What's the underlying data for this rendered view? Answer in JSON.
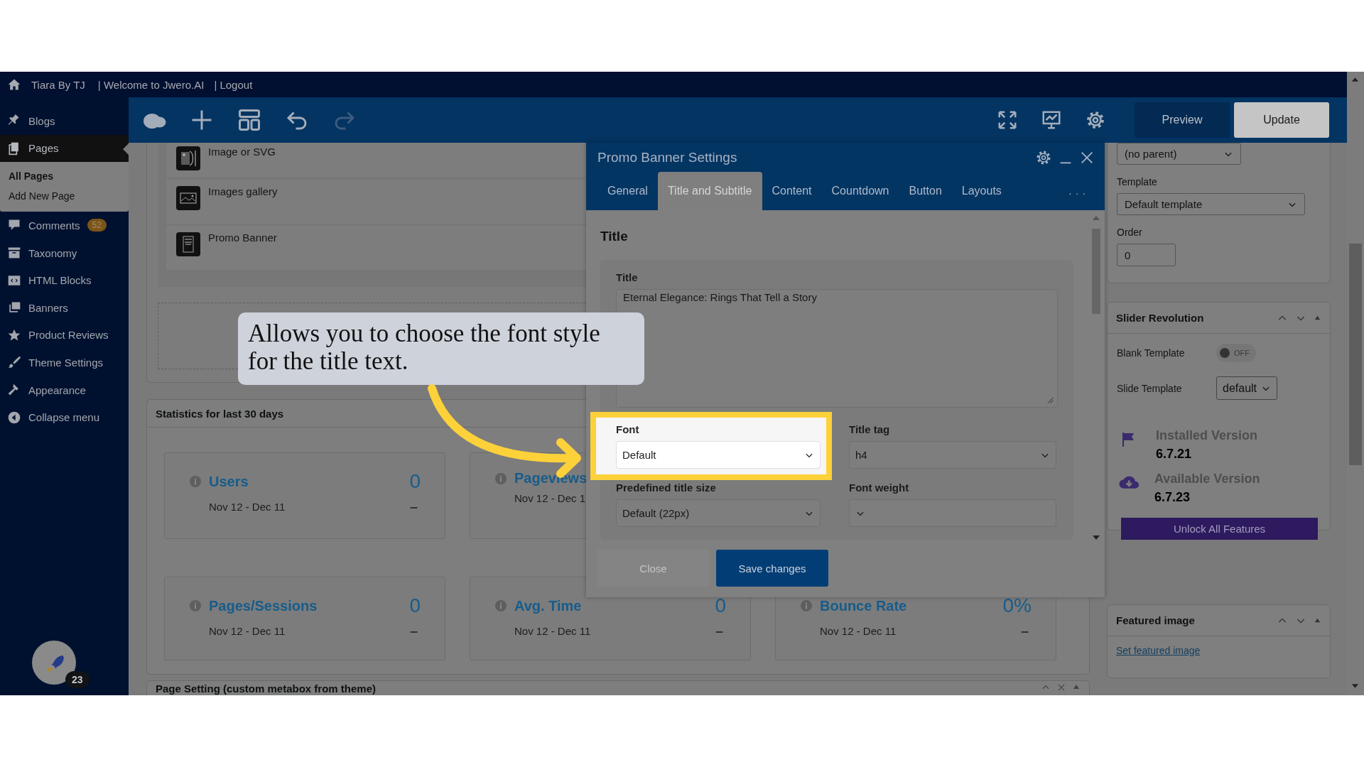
{
  "admin_bar": {
    "site": "Tiara By TJ",
    "links": [
      "| Welcome to Jwero.AI",
      "| Logout"
    ]
  },
  "sidebar": {
    "items": [
      {
        "label": "Blogs",
        "kind": "pin",
        "selected": false
      },
      {
        "label": "Pages",
        "kind": "pages",
        "selected": true,
        "children": [
          {
            "label": "All Pages",
            "selected": true
          },
          {
            "label": "Add New Page",
            "selected": false
          }
        ]
      },
      {
        "label": "Comments",
        "kind": "comment",
        "selected": false,
        "badge": "52"
      },
      {
        "label": "Taxonomy",
        "kind": "archive",
        "selected": false
      },
      {
        "label": "HTML Blocks",
        "kind": "code",
        "selected": false
      },
      {
        "label": "Banners",
        "kind": "banners",
        "selected": false
      },
      {
        "label": "Product Reviews",
        "kind": "star",
        "selected": false
      },
      {
        "label": "Theme Settings",
        "kind": "brush",
        "selected": false
      },
      {
        "label": "Appearance",
        "kind": "hammer",
        "selected": false
      },
      {
        "label": "Collapse menu",
        "kind": "collapse",
        "selected": false
      }
    ],
    "avatar_badge": "23"
  },
  "toolbar": {
    "left_tools": [
      {
        "kind": "cloud",
        "disabled": false
      },
      {
        "kind": "plus",
        "disabled": false
      },
      {
        "kind": "layout",
        "disabled": false
      },
      {
        "kind": "undo",
        "disabled": false
      },
      {
        "kind": "redo",
        "disabled": true
      }
    ],
    "right_tools": [
      {
        "kind": "expand"
      },
      {
        "kind": "chart"
      },
      {
        "kind": "gear"
      }
    ],
    "buttons": [
      {
        "label": "Preview",
        "kind": "primary"
      },
      {
        "label": "Update",
        "kind": "secondary"
      }
    ]
  },
  "elements": [
    {
      "label": "Image or SVG",
      "kind": "image-svg"
    },
    {
      "label": "Images gallery",
      "kind": "gallery"
    },
    {
      "label": "Promo Banner",
      "kind": "banner"
    }
  ],
  "statistics": {
    "title": "Statistics for last 30 days",
    "cards": [
      {
        "title": "Users",
        "value": "0",
        "change": "–",
        "range": "Nov 12 - Dec 11"
      },
      {
        "title": "Pageviews",
        "range": "Nov 12 - Dec 1"
      },
      {
        "title": "Pages/Sessions",
        "value": "0",
        "change": "–",
        "range": "Nov 12 - Dec 11"
      },
      {
        "title": "Avg. Time",
        "value": "0",
        "change": "–",
        "range": "Nov 12 - Dec 11"
      },
      {
        "title": "Bounce Rate",
        "value": "0%",
        "change": "–",
        "range": "Nov 12 - Dec 11"
      }
    ]
  },
  "page_setting": {
    "title": "Page Setting (custom metabox from theme)"
  },
  "modal": {
    "title": "Promo Banner Settings",
    "tabs": [
      {
        "label": "General",
        "selected": false
      },
      {
        "label": "Title and Subtitle",
        "selected": true
      },
      {
        "label": "Content",
        "selected": false
      },
      {
        "label": "Countdown",
        "selected": false
      },
      {
        "label": "Button",
        "selected": false
      },
      {
        "label": "Layouts",
        "selected": false
      }
    ],
    "more": ". . .",
    "section": "Title",
    "title_label": "Title",
    "title_value": "Eternal Elegance: Rings That Tell a Story",
    "fields": [
      {
        "label": "Font",
        "value": "Default",
        "highlighted": true
      },
      {
        "label": "Title tag",
        "value": "h4",
        "highlighted": false
      },
      {
        "label": "Predefined title size",
        "value": "Default (22px)",
        "highlighted": false
      },
      {
        "label": "Font weight",
        "highlighted": false
      }
    ],
    "buttons": [
      {
        "label": "Close",
        "disabled": true
      },
      {
        "label": "Save changes",
        "disabled": false
      }
    ]
  },
  "page_attributes": {
    "parent": "(no parent)",
    "template_label": "Template",
    "template": "Default template",
    "order_label": "Order",
    "order": "0"
  },
  "slider_revolution": {
    "title": "Slider Revolution",
    "blank_template_label": "Blank Template",
    "blank_template_on": false,
    "toggle_text": "OFF",
    "slide_template_label": "Slide Template",
    "slide_template": "default",
    "installed_label": "Installed Version",
    "installed": "6.7.21",
    "available_label": "Available Version",
    "available": "6.7.23",
    "unlock": "Unlock All Features"
  },
  "featured_image": {
    "title": "Featured image",
    "link": "Set featured image"
  },
  "callout": {
    "text": "Allows you to choose the font style for the title text."
  }
}
